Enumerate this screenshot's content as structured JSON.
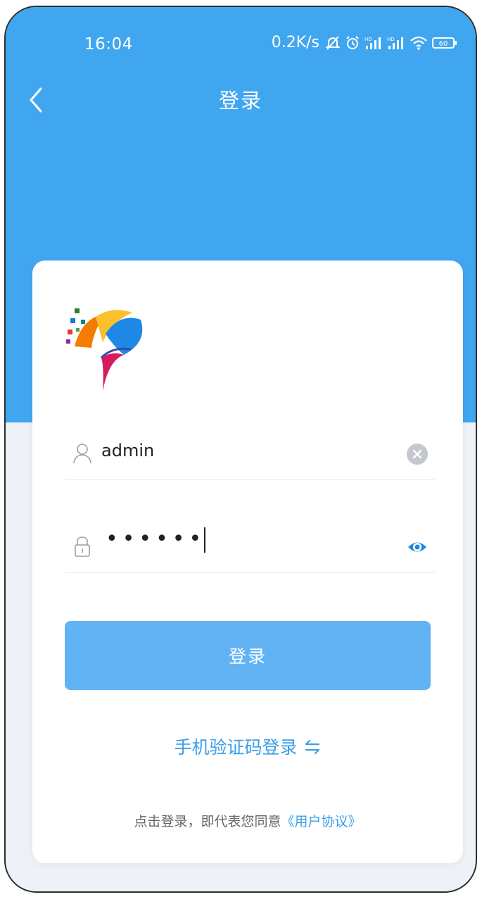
{
  "status_bar": {
    "time": "16:04",
    "network_speed": "0.2K/s",
    "battery": "60",
    "icons": [
      "mute-icon",
      "alarm-icon",
      "signal-hd-icon",
      "signal-hd-icon",
      "wifi-icon",
      "battery-icon"
    ]
  },
  "nav": {
    "title": "登录",
    "back_icon": "chevron-left-icon"
  },
  "login_form": {
    "username_value": "admin",
    "password_mask": "••••••",
    "user_icon": "user-icon",
    "lock_icon": "lock-icon",
    "clear_icon": "clear-icon",
    "eye_icon": "eye-icon"
  },
  "login_button": {
    "label": "登录"
  },
  "sms_login": {
    "label": "手机验证码登录",
    "icon": "swap-icon"
  },
  "agreement": {
    "prefix": "点击登录，即代表您同意",
    "link": "《用户协议》"
  },
  "colors": {
    "header_bg": "#41a6f0",
    "primary_button": "#62b3f4",
    "link": "#3a9fe8",
    "page_bg": "#eef2f6"
  }
}
